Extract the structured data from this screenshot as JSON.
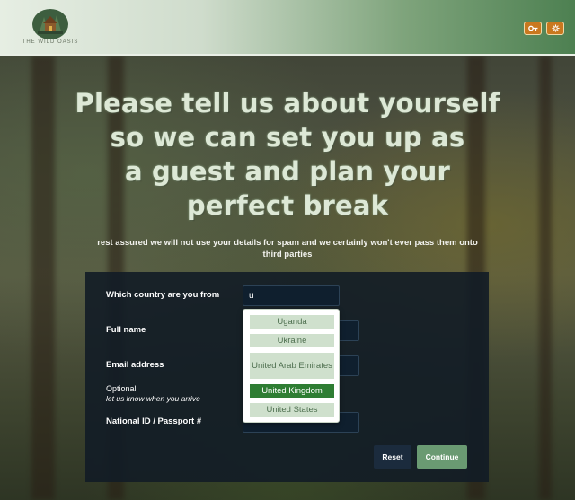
{
  "header": {
    "logo_text": "THE WILD OASIS",
    "key_icon": "key-icon",
    "settings_icon": "gear-icon"
  },
  "headline": {
    "line1": "Please tell us about yourself",
    "line2": "so we can set you up as",
    "line3": "a guest and plan your",
    "line4": "perfect break"
  },
  "subline": "rest assured we will not use your details for spam and we certainly won't ever pass them onto third parties",
  "form": {
    "country_label": "Which country are you from",
    "country_value": "u",
    "fullname_label": "Full name",
    "fullname_value": "",
    "email_label": "Email address",
    "email_value": "",
    "optional_label": "Optional",
    "arrival_label": "let us know when you arrive",
    "national_id_label": "National ID / Passport #",
    "national_id_value": "",
    "dropdown_options": [
      "Uganda",
      "Ukraine",
      "United Arab Emirates",
      "United Kingdom",
      "United States"
    ],
    "selected_option": "United Kingdom",
    "reset_label": "Reset",
    "continue_label": "Continue"
  },
  "colors": {
    "accent": "#2e7d33",
    "continue_bg": "#6a9a72",
    "reset_bg": "#1b2b3d",
    "header_button": "#c9781f"
  }
}
